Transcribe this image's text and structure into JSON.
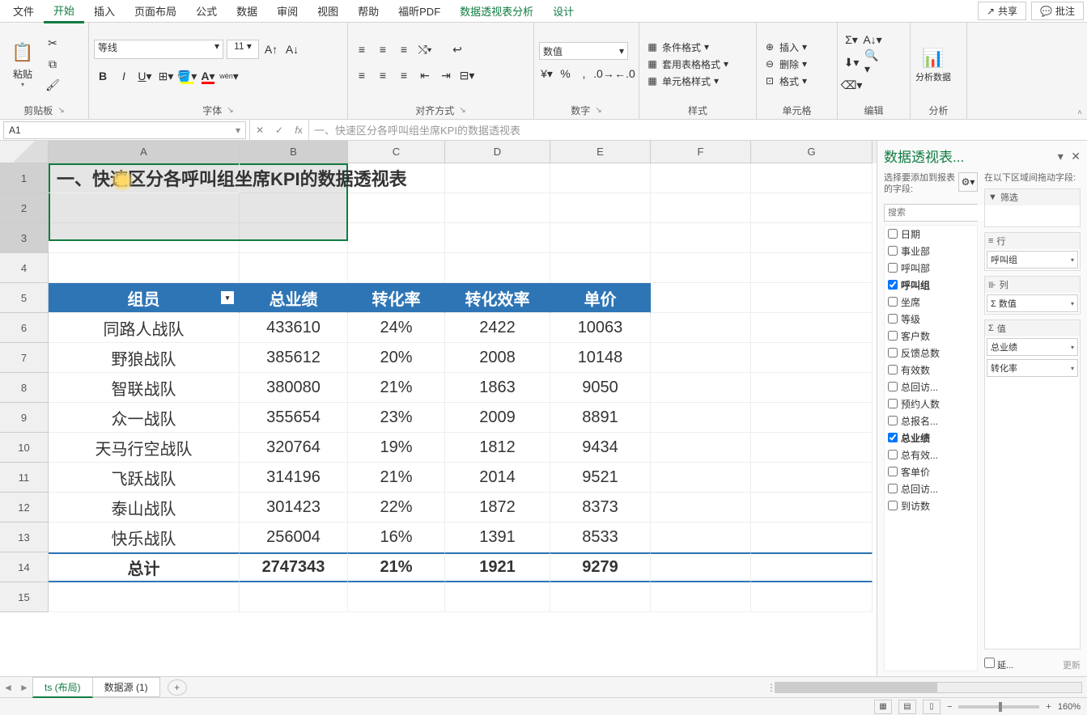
{
  "ribbonTabs": [
    "文件",
    "开始",
    "插入",
    "页面布局",
    "公式",
    "数据",
    "审阅",
    "视图",
    "帮助",
    "福昕PDF",
    "数据透视表分析",
    "设计"
  ],
  "activeTab": "开始",
  "shareLabel": "共享",
  "commentLabel": "批注",
  "groups": {
    "clipboard": {
      "label": "剪贴板",
      "paste": "粘贴"
    },
    "font": {
      "label": "字体",
      "name": "等线",
      "size": "11"
    },
    "align": {
      "label": "对齐方式"
    },
    "number": {
      "label": "数字",
      "format": "数值"
    },
    "styles": {
      "label": "样式",
      "cond": "条件格式",
      "table": "套用表格格式",
      "cell": "单元格样式"
    },
    "cells": {
      "label": "单元格",
      "insert": "插入",
      "delete": "删除",
      "format": "格式"
    },
    "editing": {
      "label": "编辑"
    },
    "analysis": {
      "label": "分析",
      "btn": "分析数据"
    }
  },
  "nameBox": "A1",
  "formulaBar": "一、快速区分各呼叫组坐席KPI的数据透视表",
  "cols": [
    "A",
    "B",
    "C",
    "D",
    "E",
    "F",
    "G"
  ],
  "rowCount": 15,
  "titleText": "一、快速区分各呼叫组坐席KPI的数据透视表",
  "pivotHeaders": [
    "组员",
    "总业绩",
    "转化率",
    "转化效率",
    "单价"
  ],
  "pivotRows": [
    {
      "a": "同路人战队",
      "b": "433610",
      "c": "24%",
      "d": "2422",
      "e": "10063"
    },
    {
      "a": "野狼战队",
      "b": "385612",
      "c": "20%",
      "d": "2008",
      "e": "10148"
    },
    {
      "a": "智联战队",
      "b": "380080",
      "c": "21%",
      "d": "1863",
      "e": "9050"
    },
    {
      "a": "众一战队",
      "b": "355654",
      "c": "23%",
      "d": "2009",
      "e": "8891"
    },
    {
      "a": "天马行空战队",
      "b": "320764",
      "c": "19%",
      "d": "1812",
      "e": "9434"
    },
    {
      "a": "飞跃战队",
      "b": "314196",
      "c": "21%",
      "d": "2014",
      "e": "9521"
    },
    {
      "a": "泰山战队",
      "b": "301423",
      "c": "22%",
      "d": "1872",
      "e": "8373"
    },
    {
      "a": "快乐战队",
      "b": "256004",
      "c": "16%",
      "d": "1391",
      "e": "8533"
    }
  ],
  "pivotTotal": {
    "a": "总计",
    "b": "2747343",
    "c": "21%",
    "d": "1921",
    "e": "9279"
  },
  "chart_data": {
    "type": "table",
    "title": "一、快速区分各呼叫组坐席KPI的数据透视表",
    "columns": [
      "组员",
      "总业绩",
      "转化率",
      "转化效率",
      "单价"
    ],
    "rows": [
      [
        "同路人战队",
        433610,
        "24%",
        2422,
        10063
      ],
      [
        "野狼战队",
        385612,
        "20%",
        2008,
        10148
      ],
      [
        "智联战队",
        380080,
        "21%",
        1863,
        9050
      ],
      [
        "众一战队",
        355654,
        "23%",
        2009,
        8891
      ],
      [
        "天马行空战队",
        320764,
        "19%",
        1812,
        9434
      ],
      [
        "飞跃战队",
        314196,
        "21%",
        2014,
        9521
      ],
      [
        "泰山战队",
        301423,
        "22%",
        1872,
        8373
      ],
      [
        "快乐战队",
        256004,
        "16%",
        1391,
        8533
      ],
      [
        "总计",
        2747343,
        "21%",
        1921,
        9279
      ]
    ]
  },
  "taskPane": {
    "title": "数据透视表...",
    "hintLeft": "选择要添加到报表的字段:",
    "hintRight": "在以下区域间拖动字段:",
    "searchPlaceholder": "搜索",
    "fields": [
      {
        "label": "日期",
        "checked": false
      },
      {
        "label": "事业部",
        "checked": false
      },
      {
        "label": "呼叫部",
        "checked": false
      },
      {
        "label": "呼叫组",
        "checked": true,
        "bold": true
      },
      {
        "label": "坐席",
        "checked": false
      },
      {
        "label": "等级",
        "checked": false
      },
      {
        "label": "客户数",
        "checked": false
      },
      {
        "label": "反馈总数",
        "checked": false
      },
      {
        "label": "有效数",
        "checked": false
      },
      {
        "label": "总回访...",
        "checked": false
      },
      {
        "label": "预约人数",
        "checked": false
      },
      {
        "label": "总报名...",
        "checked": false
      },
      {
        "label": "总业绩",
        "checked": true,
        "bold": true
      },
      {
        "label": "总有效...",
        "checked": false
      },
      {
        "label": "客单价",
        "checked": false
      },
      {
        "label": "总回访...",
        "checked": false
      },
      {
        "label": "到访数",
        "checked": false
      }
    ],
    "zones": {
      "filter": {
        "title": "筛选",
        "items": []
      },
      "rows": {
        "title": "行",
        "items": [
          "呼叫组"
        ]
      },
      "cols": {
        "title": "列",
        "items": [
          "Σ 数值"
        ]
      },
      "vals": {
        "title": "值",
        "items": [
          "总业绩",
          "转化率"
        ]
      }
    },
    "deferLabel": "延...",
    "updateLabel": "更新"
  },
  "sheetTabs": [
    {
      "label": "ts (布局)",
      "active": true
    },
    {
      "label": "数据源 (1)",
      "active": false
    }
  ],
  "zoom": "160%"
}
